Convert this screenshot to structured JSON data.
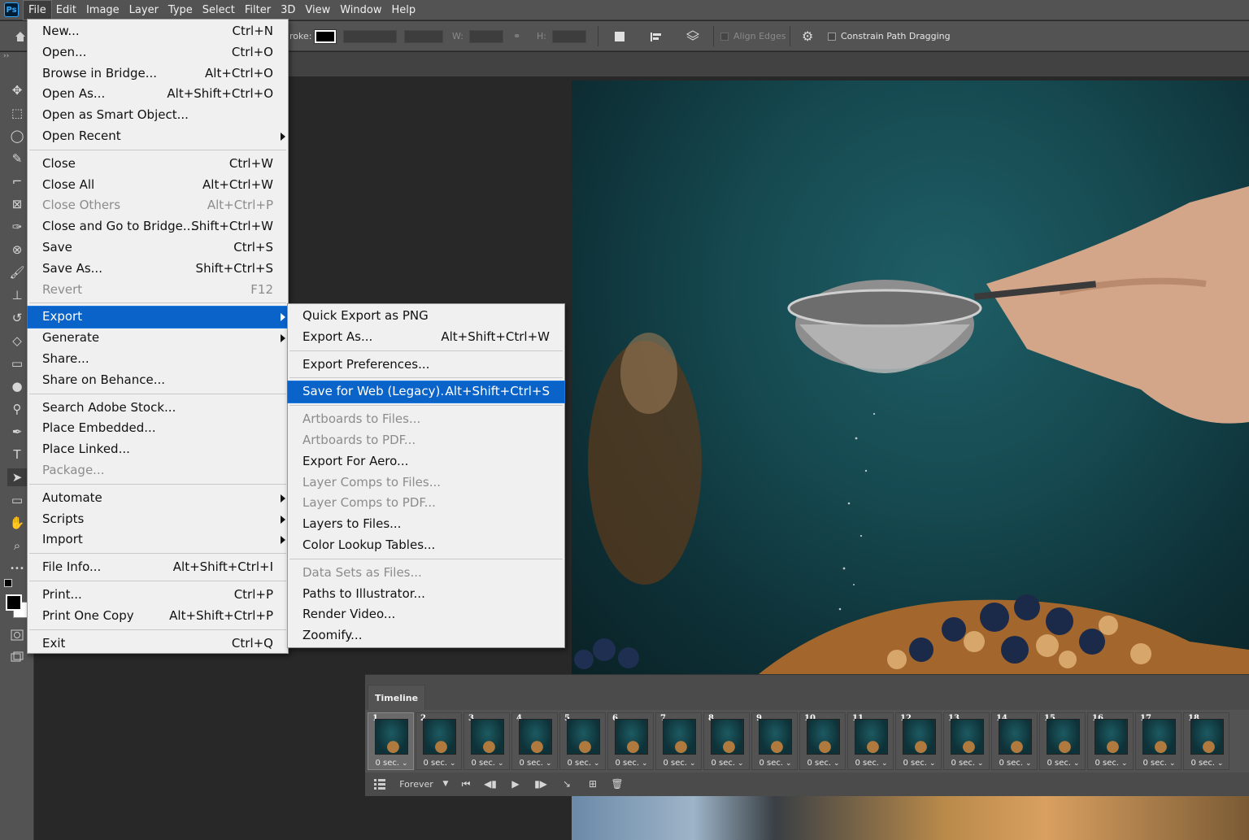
{
  "app": {
    "logo": "Ps"
  },
  "menubar": [
    "File",
    "Edit",
    "Image",
    "Layer",
    "Type",
    "Select",
    "Filter",
    "3D",
    "View",
    "Window",
    "Help"
  ],
  "options": {
    "stroke_label": "roke:",
    "w_label": "W:",
    "h_label": "H:",
    "align_edges": "Align Edges",
    "constrain": "Constrain Path Dragging"
  },
  "tools": [
    "move-icon",
    "marquee-icon",
    "lasso-icon",
    "quick-select-icon",
    "crop-icon",
    "frame-icon",
    "eyedropper-icon",
    "patch-icon",
    "brush-icon",
    "stamp-icon",
    "history-brush-icon",
    "eraser-icon",
    "gradient-icon",
    "blur-icon",
    "dodge-icon",
    "pen-icon",
    "type-icon",
    "path-select-icon",
    "rectangle-icon",
    "hand-icon",
    "zoom-icon",
    "more-tools-icon"
  ],
  "file_menu": [
    {
      "label": "New...",
      "shortcut": "Ctrl+N"
    },
    {
      "label": "Open...",
      "shortcut": "Ctrl+O"
    },
    {
      "label": "Browse in Bridge...",
      "shortcut": "Alt+Ctrl+O"
    },
    {
      "label": "Open As...",
      "shortcut": "Alt+Shift+Ctrl+O"
    },
    {
      "label": "Open as Smart Object...",
      "shortcut": ""
    },
    {
      "label": "Open Recent",
      "shortcut": "",
      "submenu": true
    },
    {
      "sep": true
    },
    {
      "label": "Close",
      "shortcut": "Ctrl+W"
    },
    {
      "label": "Close All",
      "shortcut": "Alt+Ctrl+W"
    },
    {
      "label": "Close Others",
      "shortcut": "Alt+Ctrl+P",
      "disabled": true
    },
    {
      "label": "Close and Go to Bridge...",
      "shortcut": "Shift+Ctrl+W"
    },
    {
      "label": "Save",
      "shortcut": "Ctrl+S"
    },
    {
      "label": "Save As...",
      "shortcut": "Shift+Ctrl+S"
    },
    {
      "label": "Revert",
      "shortcut": "F12",
      "disabled": true
    },
    {
      "sep": true
    },
    {
      "label": "Export",
      "shortcut": "",
      "submenu": true,
      "highlighted": true
    },
    {
      "label": "Generate",
      "shortcut": "",
      "submenu": true
    },
    {
      "label": "Share...",
      "shortcut": ""
    },
    {
      "label": "Share on Behance...",
      "shortcut": ""
    },
    {
      "sep": true
    },
    {
      "label": "Search Adobe Stock...",
      "shortcut": ""
    },
    {
      "label": "Place Embedded...",
      "shortcut": ""
    },
    {
      "label": "Place Linked...",
      "shortcut": ""
    },
    {
      "label": "Package...",
      "shortcut": "",
      "disabled": true
    },
    {
      "sep": true
    },
    {
      "label": "Automate",
      "shortcut": "",
      "submenu": true
    },
    {
      "label": "Scripts",
      "shortcut": "",
      "submenu": true
    },
    {
      "label": "Import",
      "shortcut": "",
      "submenu": true
    },
    {
      "sep": true
    },
    {
      "label": "File Info...",
      "shortcut": "Alt+Shift+Ctrl+I"
    },
    {
      "sep": true
    },
    {
      "label": "Print...",
      "shortcut": "Ctrl+P"
    },
    {
      "label": "Print One Copy",
      "shortcut": "Alt+Shift+Ctrl+P"
    },
    {
      "sep": true
    },
    {
      "label": "Exit",
      "shortcut": "Ctrl+Q"
    }
  ],
  "export_menu": [
    {
      "label": "Quick Export as PNG",
      "shortcut": ""
    },
    {
      "label": "Export As...",
      "shortcut": "Alt+Shift+Ctrl+W"
    },
    {
      "sep": true
    },
    {
      "label": "Export Preferences...",
      "shortcut": ""
    },
    {
      "sep": true
    },
    {
      "label": "Save for Web (Legacy)...",
      "shortcut": "Alt+Shift+Ctrl+S",
      "highlighted": true
    },
    {
      "sep": true
    },
    {
      "label": "Artboards to Files...",
      "shortcut": "",
      "disabled": true
    },
    {
      "label": "Artboards to PDF...",
      "shortcut": "",
      "disabled": true
    },
    {
      "label": "Export For Aero...",
      "shortcut": ""
    },
    {
      "label": "Layer Comps to Files...",
      "shortcut": "",
      "disabled": true
    },
    {
      "label": "Layer Comps to PDF...",
      "shortcut": "",
      "disabled": true
    },
    {
      "label": "Layers to Files...",
      "shortcut": ""
    },
    {
      "label": "Color Lookup Tables...",
      "shortcut": ""
    },
    {
      "sep": true
    },
    {
      "label": "Data Sets as Files...",
      "shortcut": "",
      "disabled": true
    },
    {
      "label": "Paths to Illustrator...",
      "shortcut": ""
    },
    {
      "label": "Render Video...",
      "shortcut": ""
    },
    {
      "label": "Zoomify...",
      "shortcut": ""
    }
  ],
  "timeline": {
    "title": "Timeline",
    "frames": [
      "1",
      "2",
      "3",
      "4",
      "5",
      "6",
      "7",
      "8",
      "9",
      "10",
      "11",
      "12",
      "13",
      "14",
      "15",
      "16",
      "17",
      "18"
    ],
    "delay": "0 sec.",
    "loop": "Forever"
  },
  "colors": {
    "highlight": "#0a63c9",
    "menu_bg": "#f0f0f0",
    "chrome": "#535353"
  }
}
